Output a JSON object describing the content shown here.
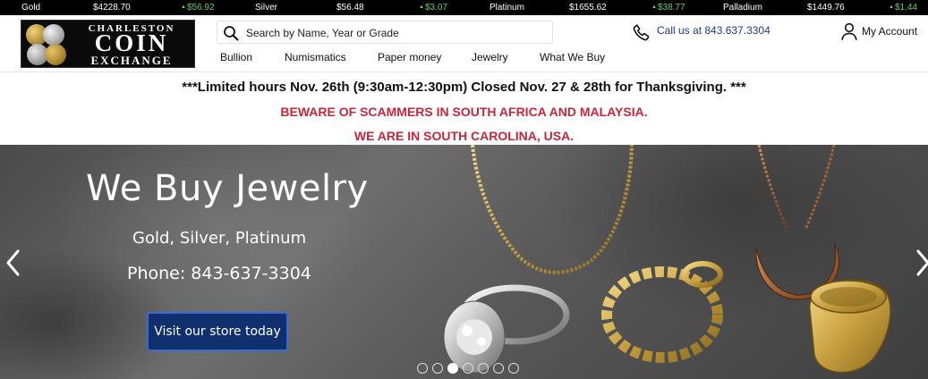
{
  "ticker": [
    {
      "metal": "Gold",
      "price": "$4228.70",
      "change": "$56.92"
    },
    {
      "metal": "Silver",
      "price": "$56.48",
      "change": "$3.07"
    },
    {
      "metal": "Platinum",
      "price": "$1655.62",
      "change": "$38.77"
    },
    {
      "metal": "Palladium",
      "price": "$1449.76",
      "change": "$1.44"
    }
  ],
  "logo": {
    "line1": "CHARLESTON",
    "line2": "COIN",
    "line3": "EXCHANGE"
  },
  "search": {
    "placeholder": "Search by Name, Year or Grade"
  },
  "nav": [
    "Bullion",
    "Numismatics",
    "Paper money",
    "Jewelry",
    "What We Buy"
  ],
  "contact": {
    "call_label": "Call us at 843.637.3304"
  },
  "account": {
    "label": "My Account"
  },
  "notices": {
    "hours": "***Limited hours Nov. 26th (9:30am-12:30pm) Closed Nov. 27 & 28th for Thanksgiving. ***",
    "warning_1": "BEWARE OF SCAMMERS IN SOUTH AFRICA AND MALAYSIA.",
    "warning_2": "WE ARE IN SOUTH CAROLINA, USA."
  },
  "hero": {
    "title": "We Buy Jewelry",
    "subtitle": "Gold, Silver, Platinum",
    "phone": "Phone: 843-637-3304",
    "cta": "Visit our store today",
    "slide_count": 7,
    "active_slide": 3
  },
  "colors": {
    "accent_blue": "#1f3a8a",
    "warning_red": "#c8263a",
    "ticker_up": "#5fd06a",
    "cta_bg": "#0f2f6e"
  }
}
